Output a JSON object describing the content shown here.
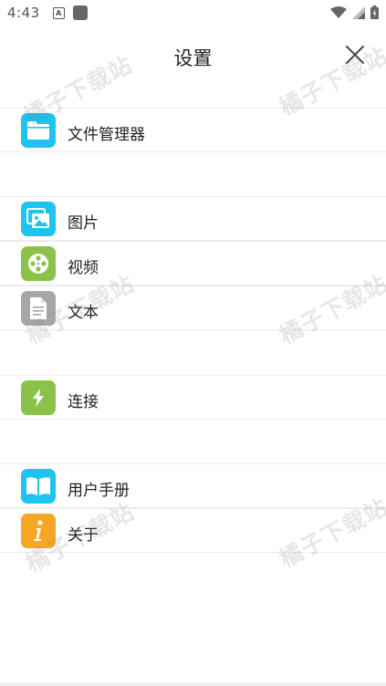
{
  "status": {
    "time": "4:43",
    "notification_letter": "A"
  },
  "header": {
    "title": "设置"
  },
  "menu": [
    {
      "label": "文件管理器",
      "icon": "folder-icon",
      "color": "#1ec3f0"
    },
    {
      "label": "图片",
      "icon": "image-icon",
      "color": "#1ec3f0"
    },
    {
      "label": "视频",
      "icon": "film-reel-icon",
      "color": "#8bc34a"
    },
    {
      "label": "文本",
      "icon": "document-icon",
      "color": "#a6a6a6"
    },
    {
      "label": "连接",
      "icon": "lightning-icon",
      "color": "#8bc34a"
    },
    {
      "label": "用户手册",
      "icon": "book-icon",
      "color": "#1ec3f0"
    },
    {
      "label": "关于",
      "icon": "info-icon",
      "color": "#f5a623"
    }
  ],
  "watermark": {
    "text": "橘子下载站"
  }
}
